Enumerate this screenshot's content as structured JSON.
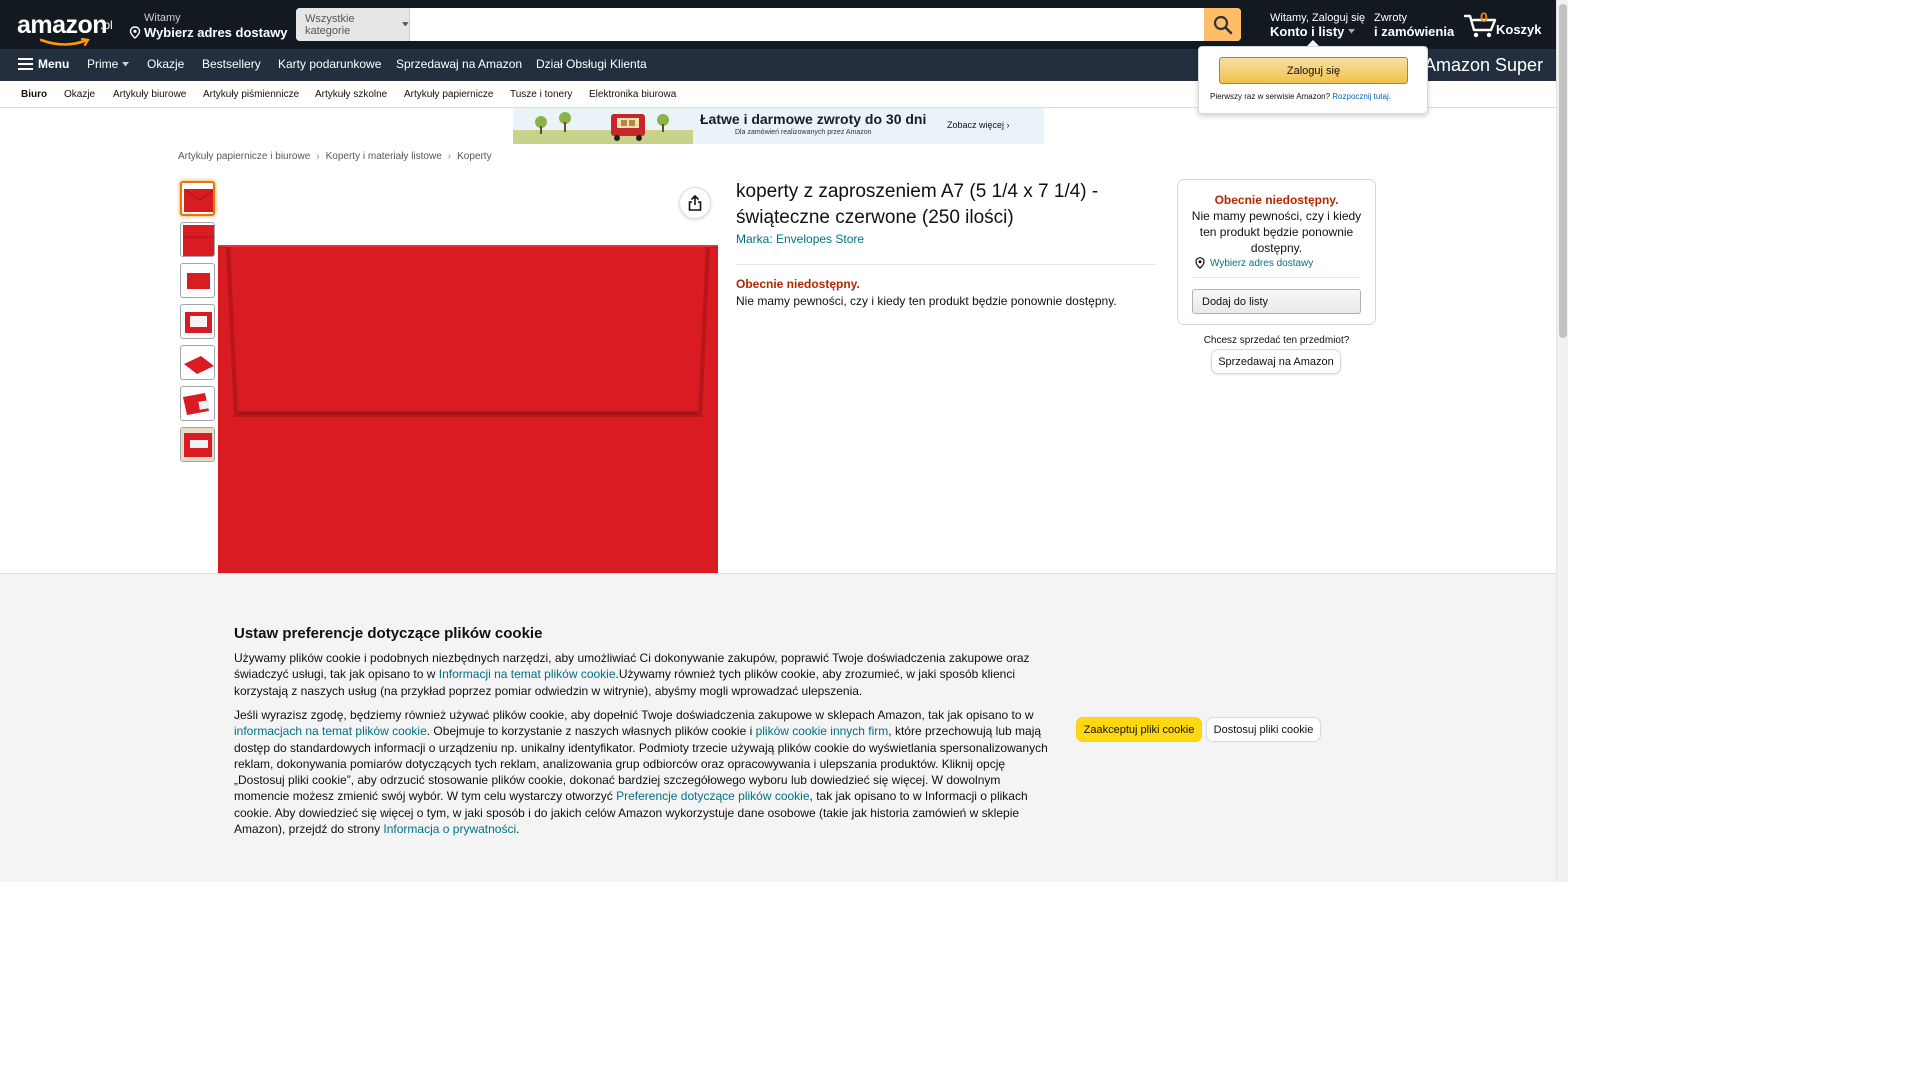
{
  "header": {
    "logo_text": "amazon",
    "logo_tld": ".pl",
    "deliver_greeting": "Witamy",
    "deliver_address": "Wybierz adres dostawy",
    "search_category": "Wszystkie kategorie",
    "search_value": "",
    "account_greeting": "Witamy, Zaloguj się",
    "account_label": "Konto i listy",
    "returns_line1": "Zwroty",
    "returns_line2": "i zamówienia",
    "cart_count": "0",
    "cart_label": "Koszyk"
  },
  "nav": {
    "menu_label": "Menu",
    "items": [
      "Prime",
      "Okazje",
      "Bestsellery",
      "Karty podarunkowe",
      "Sprzedawaj na Amazon",
      "Dział Obsługi Klienta"
    ],
    "promo": "Amazon Super"
  },
  "subnav": {
    "items": [
      "Biuro",
      "Okazje",
      "Artykuły biurowe",
      "Artykuły piśmiennicze",
      "Artykuły szkolne",
      "Artykuły papiernicze",
      "Tusze i tonery",
      "Elektronika biurowa"
    ]
  },
  "signin_popover": {
    "button_label": "Zaloguj się",
    "new_customer_text": "Pierwszy raz w serwisie Amazon?",
    "new_customer_link": "Rozpocznij tutaj."
  },
  "banner": {
    "title": "Łatwe i darmowe zwroty do 30 dni",
    "subtitle": "Dla zamówień realizowanych przez Amazon",
    "cta": "Zobacz więcej ›"
  },
  "breadcrumb": [
    "Artykuły papiernicze i biurowe",
    "Koperty i materiały listowe",
    "Koperty"
  ],
  "product": {
    "title": "koperty z zaproszeniem A7 (5 1/4 x 7 1/4) - świąteczne czerwone (250 ilości)",
    "brand": "Marka: Envelopes Store",
    "unavailable_title": "Obecnie niedostępny.",
    "unavailable_text": "Nie mamy pewności, czy i kiedy ten produkt będzie ponownie dostępny.",
    "thumbnail_count": 7,
    "envelope_color": "#d81c22"
  },
  "buybox": {
    "title": "Obecnie niedostępny.",
    "text": "Nie mamy pewności, czy i kiedy ten produkt będzie ponownie dostępny.",
    "address_link": "Wybierz adres dostawy",
    "add_to_list": "Dodaj do listy",
    "sell_question": "Chcesz sprzedać ten przedmiot?",
    "sell_button": "Sprzedawaj na Amazon"
  },
  "cookie": {
    "title": "Ustaw preferencje dotyczące plików cookie",
    "p1_a": "Używamy plików cookie i podobnych niezbędnych narzędzi, aby umożliwiać Ci dokonywanie zakupów, poprawić Twoje doświadczenia zakupowe oraz świadczyć usługi, tak jak opisano to w ",
    "p1_link": "Informacji na temat plików cookie",
    "p1_b": ".Używamy również tych plików cookie, aby zrozumieć, w jaki sposób klienci korzystają z naszych usług (na przykład poprzez pomiar odwiedzin w witrynie), abyśmy mogli wprowadzać ulepszenia.",
    "p2_a": "Jeśli wyrazisz zgodę, będziemy również używać plików cookie, aby dopełnić Twoje doświadczenia zakupowe w sklepach Amazon, tak jak opisano to w ",
    "p2_link1": "informacjach na temat plików cookie",
    "p2_b": ". Obejmuje to korzystanie z naszych własnych plików cookie i ",
    "p2_link2": "plików cookie innych firm",
    "p2_c": ", które przechowują lub mają dostęp do standardowych informacji o urządzeniu np. unikalny identyfikator. Podmioty trzecie używają plików cookie do wyświetlania spersonalizowanych reklam, dokonywania pomiarów dotyczących tych reklam, analizowania grup odbiorców oraz opracowywania i ulepszania produktów. Kliknij opcję „Dostosuj pliki cookie”, aby odrzucić stosowanie plików cookie, dokonać bardziej szczegółowego wyboru lub dowiedzieć się więcej. W dowolnym momencie możesz zmienić swój wybór. W tym celu wystarczy otworzyć ",
    "p2_link3": "Preferencje dotyczące plików cookie",
    "p2_d": ", tak jak opisano to w Informacji o plikach cookie. Aby dowiedzieć się więcej o tym, w jaki sposób i do jakich celów Amazon wykorzystuje dane osobowe (takie jak historia zamówień w sklepie Amazon), przejdź do strony ",
    "p2_link4": "Informacja o prywatności",
    "p2_e": ".",
    "accept_label": "Zaakceptuj pliki cookie",
    "customize_label": "Dostosuj pliki cookie"
  }
}
